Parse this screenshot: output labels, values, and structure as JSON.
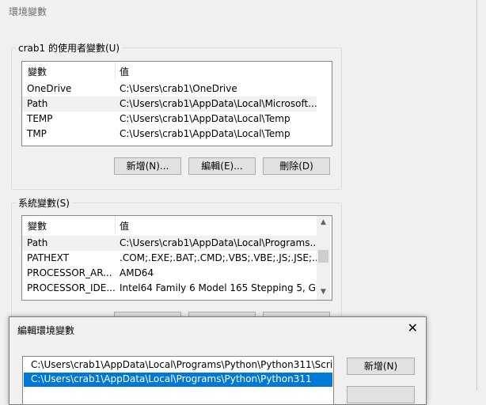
{
  "window": {
    "title": "環境變數"
  },
  "user_vars": {
    "legend": "crab1 的使用者變數(U)",
    "col_name": "變數",
    "col_value": "值",
    "rows": [
      {
        "name": "OneDrive",
        "value": "C:\\Users\\crab1\\OneDrive"
      },
      {
        "name": "Path",
        "value": "C:\\Users\\crab1\\AppData\\Local\\Microsoft..."
      },
      {
        "name": "TEMP",
        "value": "C:\\Users\\crab1\\AppData\\Local\\Temp"
      },
      {
        "name": "TMP",
        "value": "C:\\Users\\crab1\\AppData\\Local\\Temp"
      }
    ],
    "new_label": "新增(N)...",
    "edit_label": "編輯(E)...",
    "delete_label": "刪除(D)"
  },
  "system_vars": {
    "legend": "系統變數(S)",
    "col_name": "變數",
    "col_value": "值",
    "rows": [
      {
        "name": "Path",
        "value": "C:\\Users\\crab1\\AppData\\Local\\Programs..."
      },
      {
        "name": "PATHEXT",
        "value": ".COM;.EXE;.BAT;.CMD;.VBS;.VBE;.JS;.JSE;..."
      },
      {
        "name": "PROCESSOR_AR...",
        "value": "AMD64"
      },
      {
        "name": "PROCESSOR_IDE...",
        "value": "Intel64 Family 6 Model 165 Stepping 5, G..."
      }
    ]
  },
  "edit_dialog": {
    "title": "編輯環境變數",
    "close": "✕",
    "entries": [
      "C:\\Users\\crab1\\AppData\\Local\\Programs\\Python\\Python311\\Scri...",
      "C:\\Users\\crab1\\AppData\\Local\\Programs\\Python\\Python311"
    ],
    "new_label": "新增(N)"
  },
  "icons": {
    "scroll_up": "up-arrow-icon",
    "scroll_down": "down-arrow-icon"
  }
}
